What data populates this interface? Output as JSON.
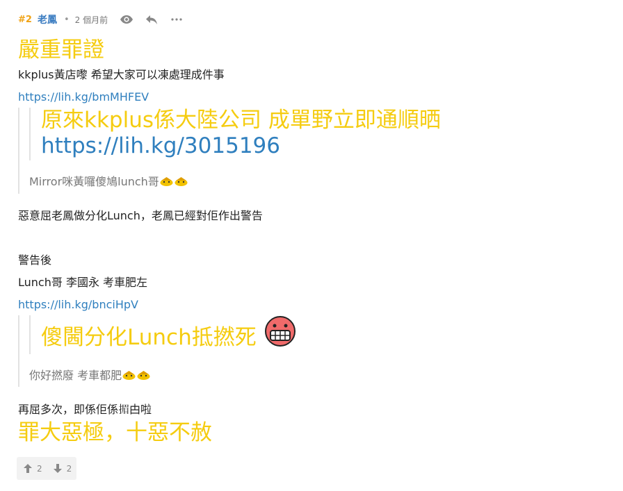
{
  "post": {
    "floor": "#2",
    "author": "老鳳",
    "separator": "•",
    "time": "2 個月前",
    "heading": "嚴重罪證",
    "line1": "kkplus黃店嚟 希望大家可以凍處理成件事",
    "link1": "https://lih.kg/bmMHFEV",
    "quote1": {
      "line1": "原來kkplus係大陸公司 成單野立即通順晒",
      "link": "https://lih.kg/3015196",
      "caption": "Mirror咪黃囉傻鳩lunch哥"
    },
    "line2": "惡意屈老鳳做分化Lunch，老鳳已經對佢作出警告",
    "line3": "警告後",
    "line4": "Lunch哥 李國永 考車肥左",
    "link2": "https://lih.kg/bnciHpV",
    "quote2": {
      "big": "傻閪分化Lunch抵撚死",
      "caption": "你好撚廢 考車都肥"
    },
    "line5": "再屈多次，即係佢係𢰲甴啦",
    "closing": "罪大惡極，十惡不赦"
  },
  "votes": {
    "up": "2",
    "down": "2"
  },
  "colors": {
    "accent_yellow": "#f5cc10",
    "link": "#2f7fbe",
    "floor": "#f0a316",
    "author": "#3a7cc1"
  },
  "icons": [
    "eye-icon",
    "reply-icon",
    "more-icon",
    "duck-emoji-icon",
    "grin-emoji-icon",
    "thumb-up-icon",
    "thumb-down-icon"
  ]
}
